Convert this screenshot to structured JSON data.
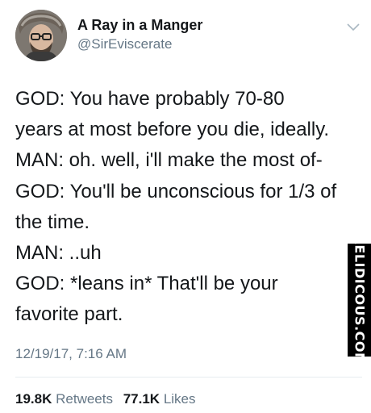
{
  "author": {
    "display_name": "A Ray in a Manger",
    "handle": "@SirEviscerate",
    "avatar_icon": "profile-photo"
  },
  "menu_icon": "chevron-down-icon",
  "tweet": {
    "lines": [
      "GOD: You have probably 70-80",
      "years at most before you die, ideally.",
      "MAN: oh. well, i'll make the most of-",
      "GOD: You'll be unconscious for 1/3 of",
      "the time.",
      "MAN: ..uh",
      "GOD: *leans in* That'll be your",
      "favorite part."
    ],
    "timestamp": "12/19/17, 7:16 AM"
  },
  "stats": {
    "retweets_count": "19.8K",
    "retweets_label": "Retweets",
    "likes_count": "77.1K",
    "likes_label": "Likes"
  },
  "watermark": "RELIDICOUS.COM",
  "colors": {
    "text_primary": "#14171a",
    "text_secondary": "#657786",
    "divider": "#e6ecf0",
    "watermark_bg": "#000000"
  }
}
